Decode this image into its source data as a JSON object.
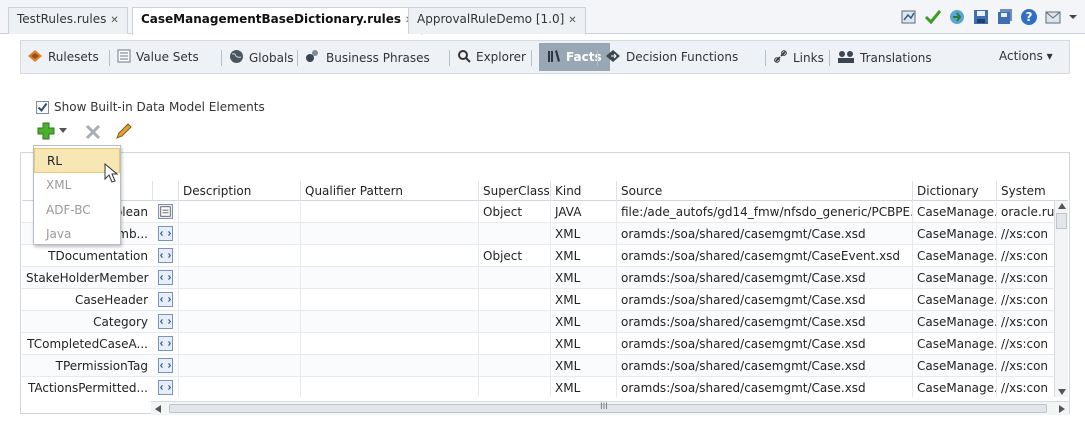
{
  "tabs": [
    {
      "label": "TestRules.rules",
      "active": false
    },
    {
      "label": "CaseManagementBaseDictionary.rules",
      "active": true
    },
    {
      "label": "ApprovalRuleDemo [1.0]",
      "active": false
    }
  ],
  "toolbar_icons": [
    "validate-icon",
    "check-icon",
    "deploy-icon",
    "save-icon",
    "save-all-icon",
    "help-icon",
    "mail-icon",
    "chevron-down-icon"
  ],
  "subnav": {
    "items": [
      {
        "label": "Rulesets",
        "icon": "rulesets-icon"
      },
      {
        "label": "Value Sets",
        "icon": "value-sets-icon"
      },
      {
        "label": "Globals",
        "icon": "globe-icon"
      },
      {
        "label": "Business Phrases",
        "icon": "business-phrases-icon"
      },
      {
        "label": "Explorer",
        "icon": "search-icon"
      },
      {
        "label": "Facts",
        "icon": "facts-icon",
        "active": true
      },
      {
        "label": "Decision Functions",
        "icon": "decision-functions-icon"
      },
      {
        "label": "Links",
        "icon": "link-icon"
      },
      {
        "label": "Translations",
        "icon": "translations-icon"
      }
    ],
    "actions_label": "Actions ▾"
  },
  "show_builtin": {
    "label": "Show Built-in Data Model Elements",
    "checked": true
  },
  "dropdown": {
    "items": [
      {
        "label": "RL",
        "selected": true
      },
      {
        "label": "XML",
        "selected": false
      },
      {
        "label": "ADF-BC",
        "selected": false
      },
      {
        "label": "Java",
        "selected": false
      }
    ]
  },
  "table": {
    "headers": [
      "",
      "",
      "Description",
      "Qualifier Pattern",
      "SuperClass",
      "Kind",
      "Source",
      "Dictionary",
      "System"
    ],
    "rows": [
      {
        "name": "olean",
        "icon": "java-class-icon",
        "description": "",
        "qualifier": "",
        "superclass": "Object",
        "kind": "JAVA",
        "source": "file:/ade_autofs/gd14_fmw/nfsdo_generic/PCBPE...",
        "dictionary": "CaseManage...",
        "system": "oracle.ru"
      },
      {
        "name": "mb...",
        "icon": "xml-icon",
        "description": "",
        "qualifier": "",
        "superclass": "",
        "kind": "XML",
        "source": "oramds:/soa/shared/casemgmt/Case.xsd",
        "dictionary": "CaseManage...",
        "system": "//xs:con"
      },
      {
        "name": "TDocumentation",
        "icon": "xml-icon",
        "description": "",
        "qualifier": "",
        "superclass": "Object",
        "kind": "XML",
        "source": "oramds:/soa/shared/casemgmt/CaseEvent.xsd",
        "dictionary": "CaseManage...",
        "system": "//xs:con"
      },
      {
        "name": "StakeHolderMember",
        "icon": "xml-icon",
        "description": "",
        "qualifier": "",
        "superclass": "",
        "kind": "XML",
        "source": "oramds:/soa/shared/casemgmt/Case.xsd",
        "dictionary": "CaseManage...",
        "system": "//xs:con"
      },
      {
        "name": "CaseHeader",
        "icon": "xml-icon",
        "description": "",
        "qualifier": "",
        "superclass": "",
        "kind": "XML",
        "source": "oramds:/soa/shared/casemgmt/Case.xsd",
        "dictionary": "CaseManage...",
        "system": "//xs:con"
      },
      {
        "name": "Category",
        "icon": "xml-icon",
        "description": "",
        "qualifier": "",
        "superclass": "",
        "kind": "XML",
        "source": "oramds:/soa/shared/casemgmt/Case.xsd",
        "dictionary": "CaseManage...",
        "system": "//xs:con"
      },
      {
        "name": "TCompletedCaseA...",
        "icon": "xml-icon",
        "description": "",
        "qualifier": "",
        "superclass": "",
        "kind": "XML",
        "source": "oramds:/soa/shared/casemgmt/Case.xsd",
        "dictionary": "CaseManage...",
        "system": "//xs:con"
      },
      {
        "name": "TPermissionTag",
        "icon": "xml-icon",
        "description": "",
        "qualifier": "",
        "superclass": "",
        "kind": "XML",
        "source": "oramds:/soa/shared/casemgmt/Case.xsd",
        "dictionary": "CaseManage...",
        "system": "//xs:con"
      },
      {
        "name": "TActionsPermitted...",
        "icon": "xml-icon",
        "description": "",
        "qualifier": "",
        "superclass": "",
        "kind": "XML",
        "source": "oramds:/soa/shared/casemgmt/Case.xsd",
        "dictionary": "CaseManage...",
        "system": "//xs:con"
      }
    ]
  },
  "hscroll_label": "III"
}
